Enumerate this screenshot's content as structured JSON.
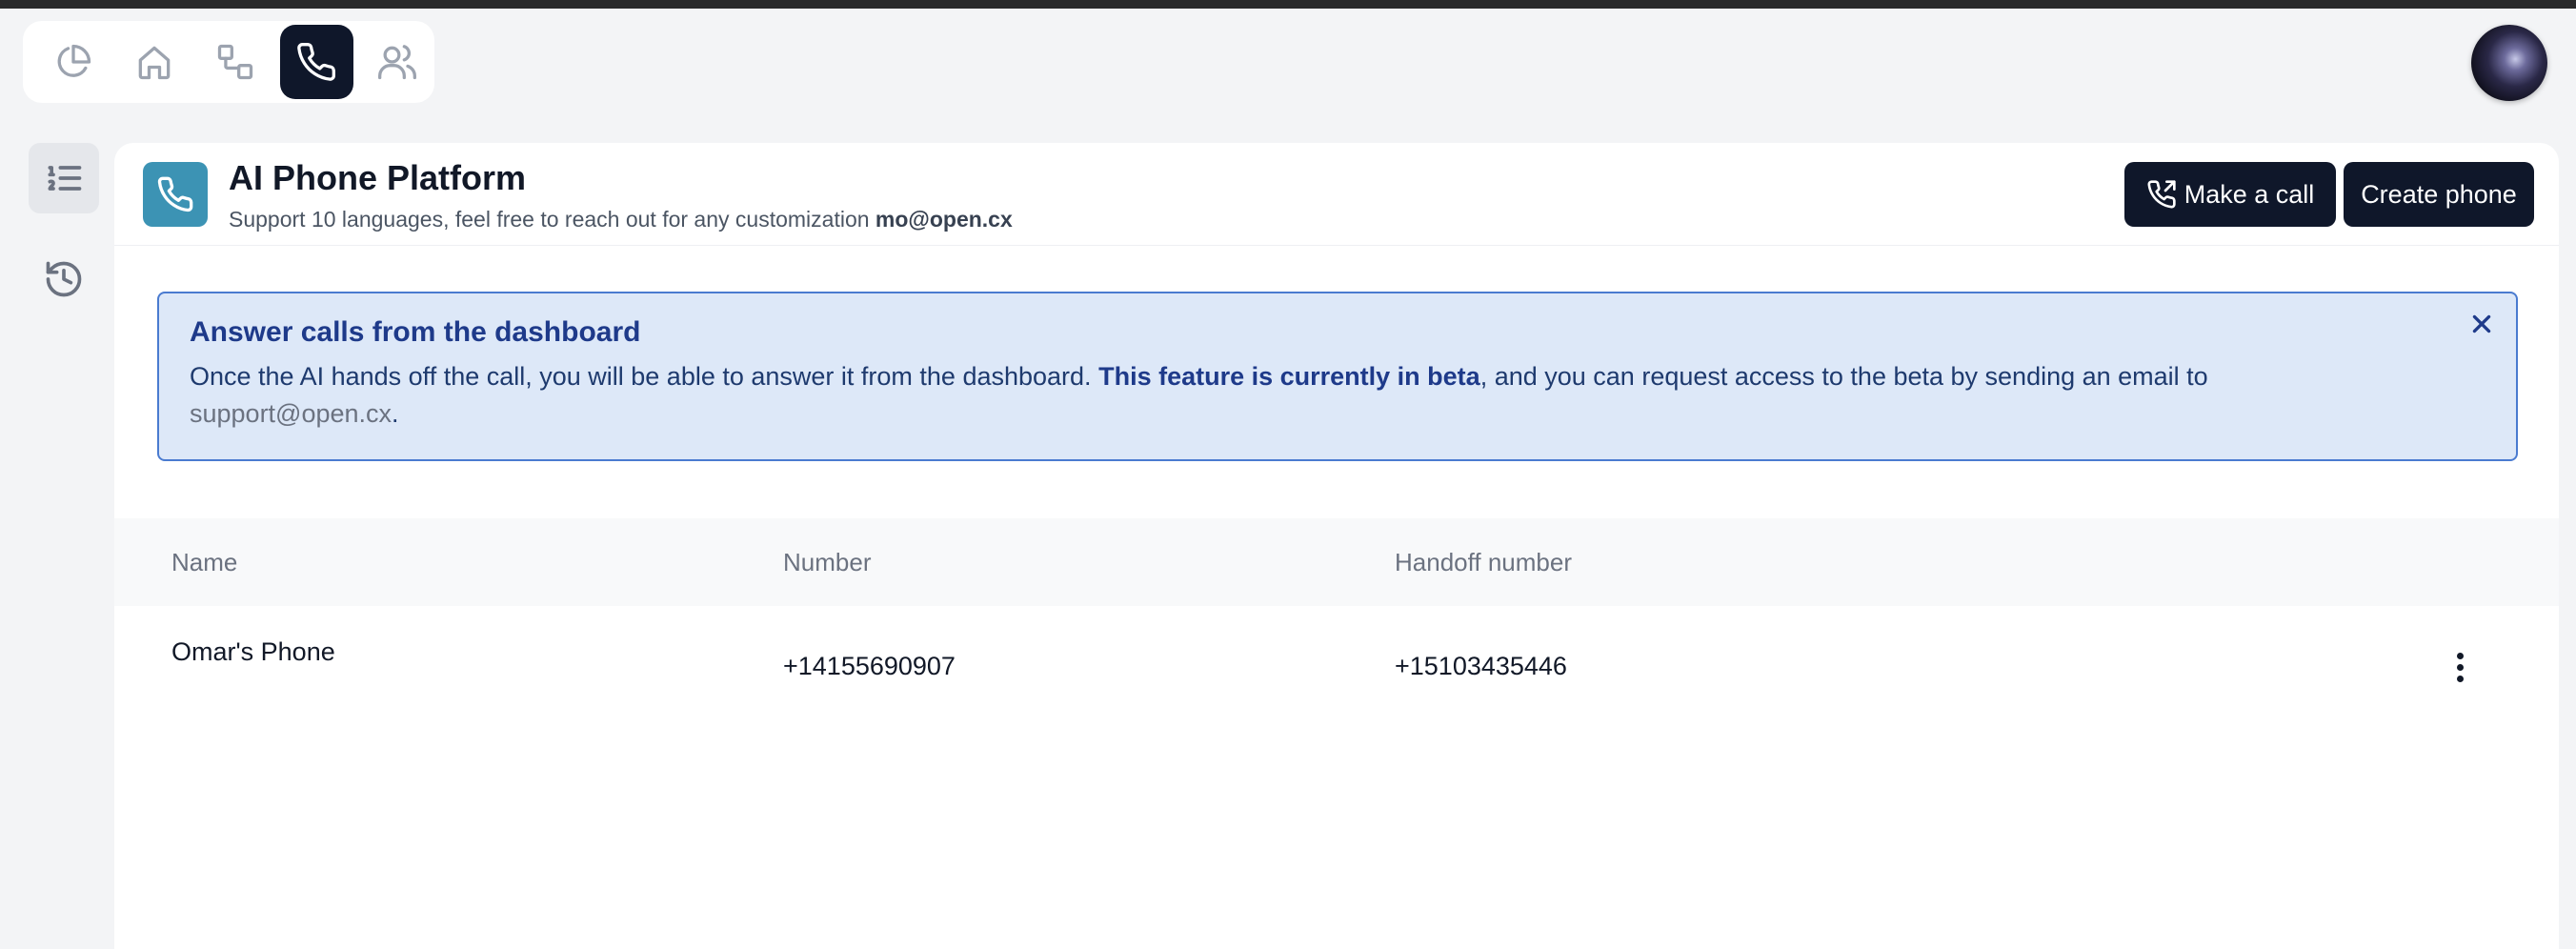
{
  "nav": {
    "items": [
      {
        "icon": "pie-chart-icon"
      },
      {
        "icon": "home-icon"
      },
      {
        "icon": "workflow-icon"
      },
      {
        "icon": "phone-icon",
        "active": true
      },
      {
        "icon": "users-icon"
      }
    ]
  },
  "rail": {
    "items": [
      {
        "icon": "list-icon",
        "active": true
      },
      {
        "icon": "history-icon"
      }
    ]
  },
  "header": {
    "title": "AI Phone Platform",
    "subtitle": "Support 10 languages, feel free to reach out for any customization",
    "email": "mo@open.cx",
    "make_call_label": "Make a call",
    "create_phone_label": "Create phone"
  },
  "banner": {
    "title": "Answer calls from the dashboard",
    "text_before": "Once the AI hands off the call, you will be able to answer it from the dashboard.",
    "text_bold": "This feature is currently in beta",
    "text_after": ", and you can request access to the beta by sending an email to",
    "link": "support@open.cx",
    "period": "."
  },
  "table": {
    "columns": [
      "Name",
      "Number",
      "Handoff number"
    ],
    "rows": [
      {
        "name": "Omar's Phone",
        "number": "+14155690907",
        "handoff": "+15103435446"
      }
    ]
  },
  "colors": {
    "accent": "#0f172a",
    "app_icon": "#3c93b4",
    "banner_bg": "#dde8f8",
    "banner_border": "#4a7bd0"
  }
}
